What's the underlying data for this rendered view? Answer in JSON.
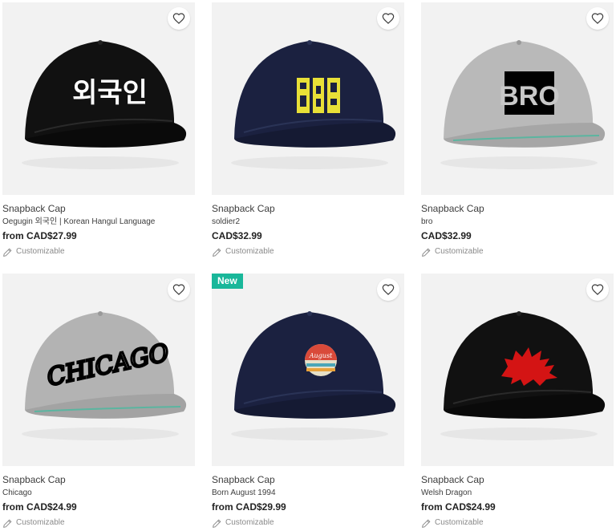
{
  "products": [
    {
      "type": "Snapback Cap",
      "name": "Oegugin 외국인 | Korean Hangul Language",
      "price": "from CAD$27.99",
      "custom": "Customizable",
      "cap_color": "#111111",
      "print_text": "외국인",
      "badge": ""
    },
    {
      "type": "Snapback Cap",
      "name": "soldier2",
      "price": "CAD$32.99",
      "custom": "Customizable",
      "cap_color": "#1b2140",
      "print_text": "",
      "badge": ""
    },
    {
      "type": "Snapback Cap",
      "name": "bro",
      "price": "CAD$32.99",
      "custom": "Customizable",
      "cap_color": "#b9b9b9",
      "print_text": "BRO",
      "badge": ""
    },
    {
      "type": "Snapback Cap",
      "name": "Chicago",
      "price": "from CAD$24.99",
      "custom": "Customizable",
      "cap_color": "#b3b3b3",
      "print_text": "CHICAGO",
      "badge": ""
    },
    {
      "type": "Snapback Cap",
      "name": "Born August 1994",
      "price": "from CAD$29.99",
      "custom": "Customizable",
      "cap_color": "#1b2140",
      "print_text": "August",
      "badge": "New"
    },
    {
      "type": "Snapback Cap",
      "name": "Welsh Dragon",
      "price": "from CAD$24.99",
      "custom": "Customizable",
      "cap_color": "#111111",
      "print_text": "",
      "badge": ""
    }
  ],
  "icons": {
    "favorite": "heart-outline-icon",
    "customize": "pencil-icon"
  }
}
